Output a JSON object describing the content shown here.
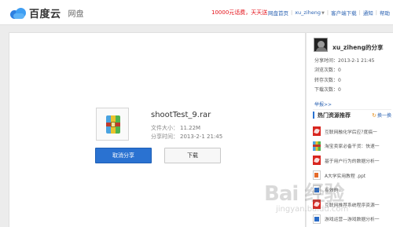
{
  "header": {
    "logo_text": "百度云",
    "logo_sub": "网盘",
    "promo": "10000元话费，天天送",
    "nav": {
      "home": "网盘首页",
      "user": "xu_ziheng",
      "client": "客户端下载",
      "notify": "通知",
      "help": "帮助"
    }
  },
  "file": {
    "name": "shootTest_9.rar",
    "size_label": "文件大小：",
    "size_value": "11.22M",
    "time_label": "分享时间：",
    "time_value": "2013-2-1 21:45",
    "icon": "rar-archive-icon"
  },
  "buttons": {
    "cancel_share": "取消分享",
    "download": "下载"
  },
  "sidebar": {
    "share_title": "xu_ziheng的分享",
    "stats": {
      "time": "分享时间：2013-2-1 21:45",
      "views": "浏览次数：0",
      "saves": "转存次数：0",
      "downloads": "下载次数：0"
    },
    "report": "举报>>",
    "hot_title": "热门资源推荐",
    "hot_change": "换一换",
    "hot_items": [
      {
        "icon": "pdf",
        "text": "互联网融化学后应?度搞一"
      },
      {
        "icon": "zip",
        "text": "淘宝卖家必备干货：快速一"
      },
      {
        "icon": "pdf",
        "text": "基于用户行为的数据分析一"
      },
      {
        "icon": "ppt",
        "text": "A大学实用教程 .ppt"
      },
      {
        "icon": "doc",
        "text": "有效的..."
      },
      {
        "icon": "pdf",
        "text": "互联网推荐系统程序资源一"
      },
      {
        "icon": "doc",
        "text": "游戏运营—游戏数据分析一"
      }
    ]
  },
  "watermark": {
    "main": "Bai 经验",
    "url": "jingyan.baidu.com"
  },
  "colors": {
    "primary_button": "#2a72d1",
    "promo_red": "#e4121a",
    "link_blue": "#2d64b3"
  }
}
